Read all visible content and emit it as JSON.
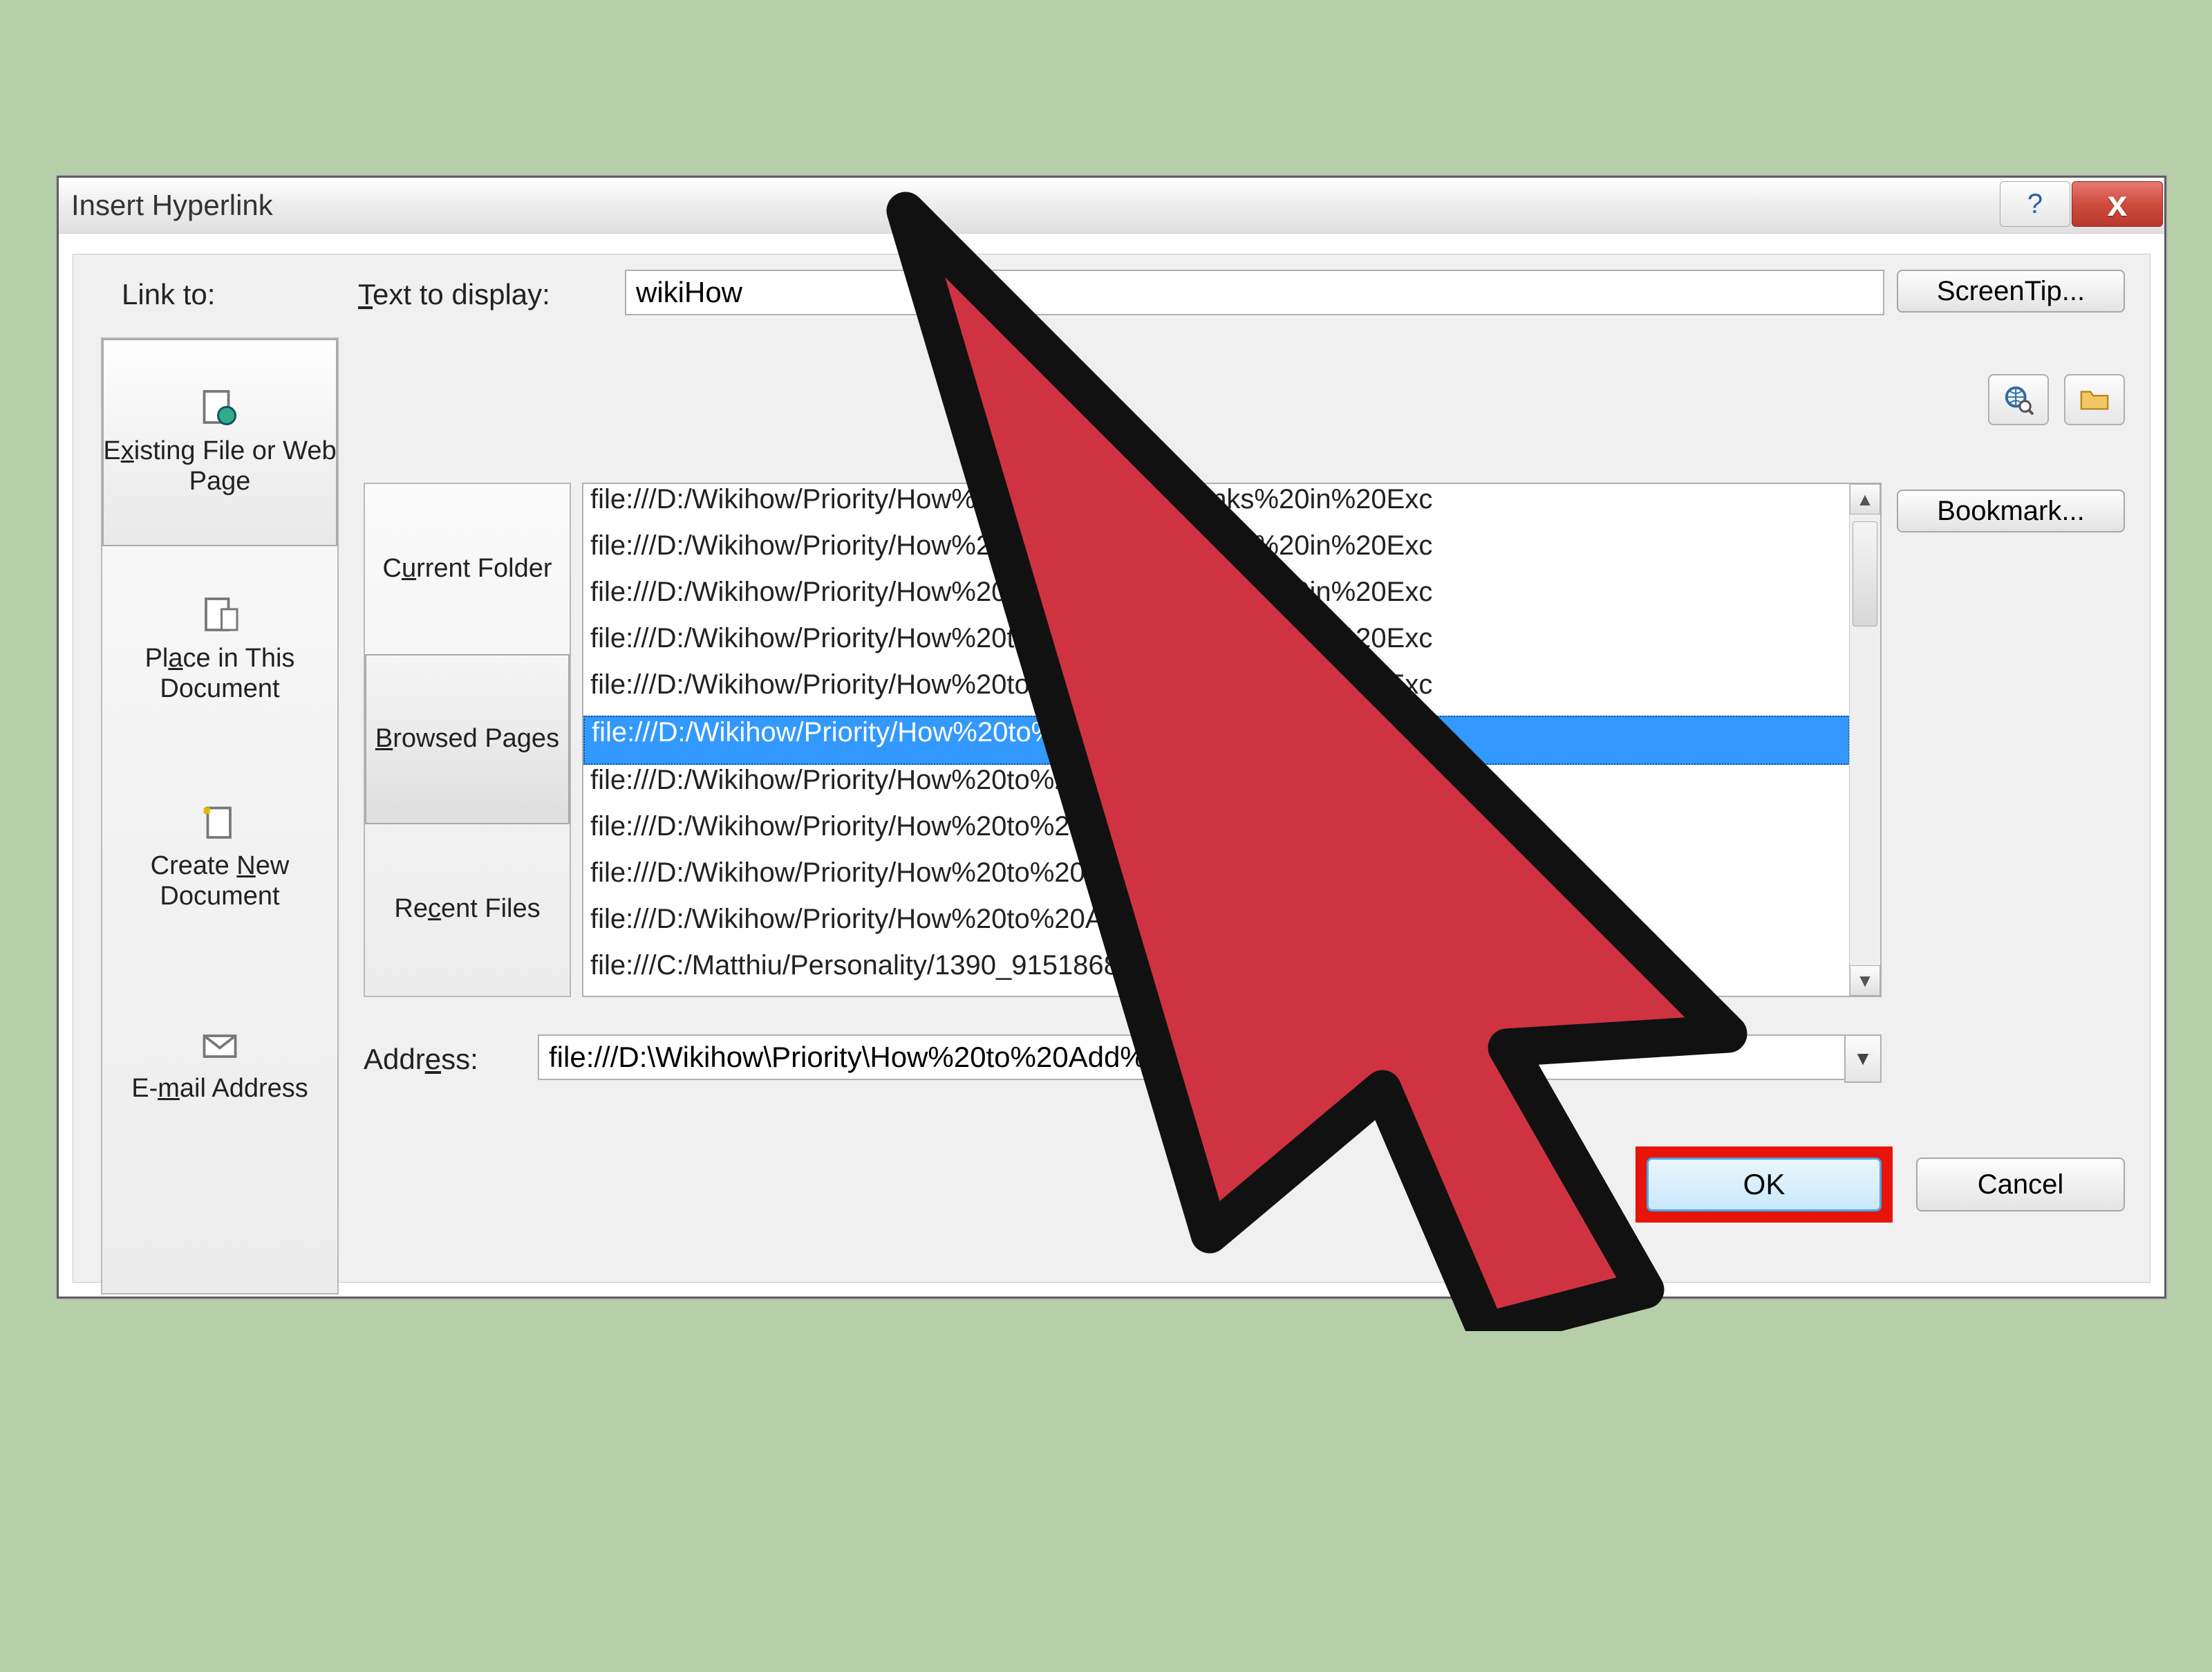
{
  "dialog": {
    "title": "Insert Hyperlink",
    "help_tooltip": "?",
    "close_label": "x"
  },
  "labels": {
    "link_to": "Link to:",
    "text_to_display_prefix": "T",
    "text_to_display_rest": "ext to display:",
    "screentip": "ScreenTip...",
    "bookmark": "Bookmark...",
    "address_prefix": "Addr",
    "address_ul": "e",
    "address_rest": "ss:",
    "ok": "OK",
    "cancel": "Cancel"
  },
  "text_to_display": {
    "value": "wikiHow"
  },
  "sidebar": {
    "items": [
      {
        "ul": "x",
        "pre": "E",
        "post": "isting File or Web Page",
        "selected": true
      },
      {
        "ul": "a",
        "pre": "Pl",
        "post": "ce in This Document",
        "selected": false
      },
      {
        "ul": "N",
        "pre": "Create ",
        "post": "ew Document",
        "selected": false
      },
      {
        "ul": "m",
        "pre": "E-",
        "post": "ail Address",
        "selected": false
      }
    ]
  },
  "midnav": {
    "items": [
      {
        "ul": "u",
        "pre": "C",
        "post": "rrent Folder",
        "selected": false
      },
      {
        "ul": "B",
        "pre": "",
        "post": "rowsed Pages",
        "selected": true
      },
      {
        "ul": "c",
        "pre": "Re",
        "post": "ent Files",
        "selected": false
      }
    ]
  },
  "file_list": {
    "items": [
      "file:///D:/Wikihow/Priority/How%20to%20Add%20Links%20in%20Exc",
      "file:///D:/Wikihow/Priority/How%20to%20Add%20Links%20in%20Exc",
      "file:///D:/Wikihow/Priority/How%20to%20Add%20Links%20in%20Exc",
      "file:///D:/Wikihow/Priority/How%20to%20Add%20Links%20in%20Exc",
      "file:///D:/Wikihow/Priority/How%20to%20Add%20Links%20in%20Exc",
      "file:///D:/Wikihow/Priority/How%20to%20Add%20Links%20in%20Exc",
      "file:///D:/Wikihow/Priority/How%20to%20Add%20Links%20in%20Exc",
      "file:///D:/Wikihow/Priority/How%20to%20Add%20Links%20in%20Exc",
      "file:///D:/Wikihow/Priority/How%20to%20Add%20Links%20in%20Exc",
      "file:///D:/Wikihow/Priority/How%20to%20Add%20Links%20in%20Exc",
      "file:///C:/Matthiu/Personality/1390_91518684"
    ],
    "selected_index": 5
  },
  "address": {
    "value": "file:///D:\\Wikihow\\Priority\\How%20to%20Add%20Links%20in%20Exc"
  },
  "colors": {
    "highlight": "#e7140c",
    "selection": "#3399ff",
    "page_bg": "#b6cfa9"
  },
  "annotation": {
    "arrow_points_to": "ok-button"
  }
}
